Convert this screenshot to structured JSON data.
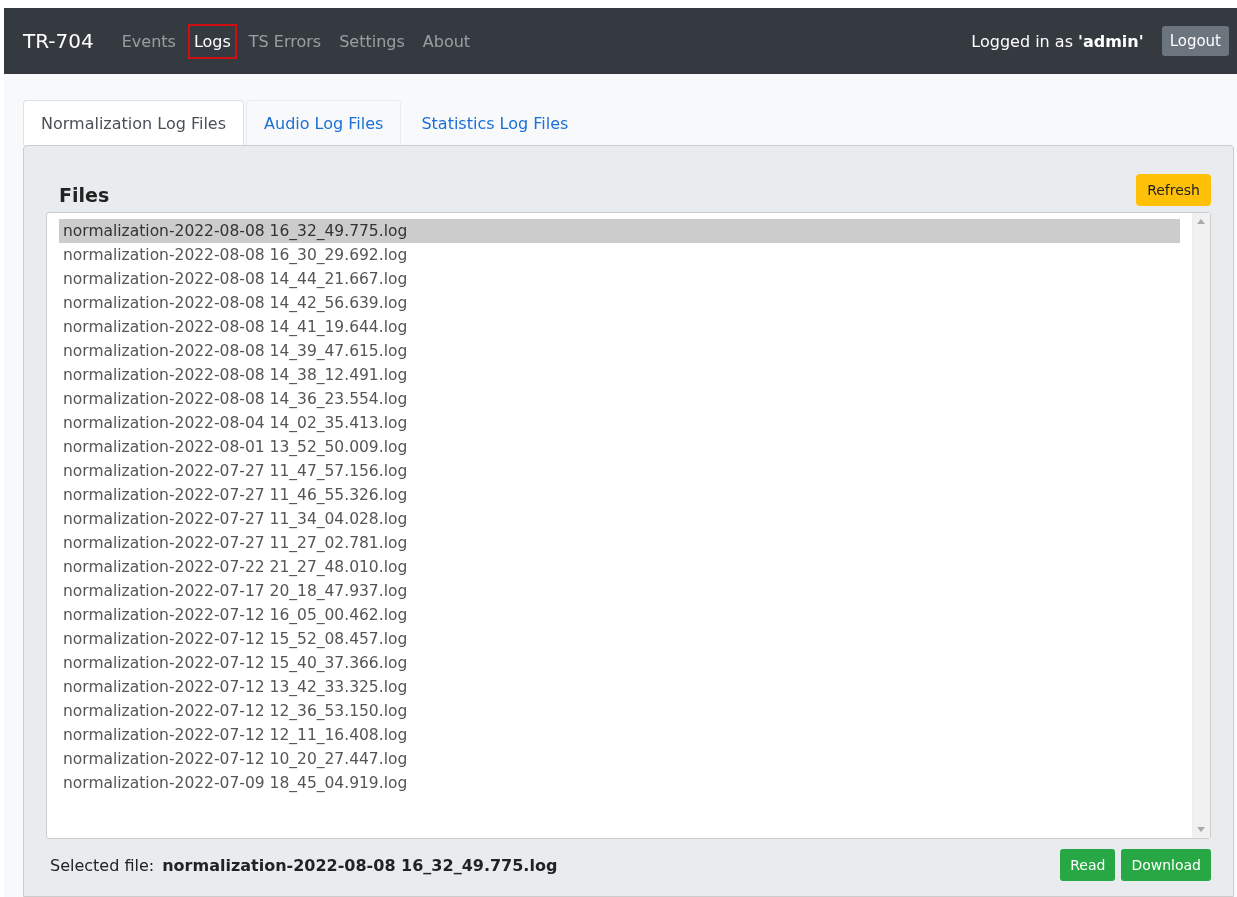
{
  "navbar": {
    "brand": "TR-704",
    "links": [
      {
        "label": "Events",
        "selected": false
      },
      {
        "label": "Logs",
        "selected": true
      },
      {
        "label": "TS Errors",
        "selected": false
      },
      {
        "label": "Settings",
        "selected": false
      },
      {
        "label": "About",
        "selected": false
      }
    ],
    "login_text": "Logged in as **'admin'**",
    "logout": "Logout"
  },
  "tabs": [
    {
      "label": "Normalization Log Files",
      "selected": true
    },
    {
      "label": "Audio Log Files",
      "selected": false
    },
    {
      "label": "Statistics Log Files",
      "selected": false
    }
  ],
  "files": {
    "title": "Files",
    "refresh": "Refresh",
    "items": [
      {
        "name": "normalization-2022-08-08 16_32_49.775.log",
        "selected": true
      },
      {
        "name": "normalization-2022-08-08 16_30_29.692.log",
        "selected": false
      },
      {
        "name": "normalization-2022-08-08 14_44_21.667.log",
        "selected": false
      },
      {
        "name": "normalization-2022-08-08 14_42_56.639.log",
        "selected": false
      },
      {
        "name": "normalization-2022-08-08 14_41_19.644.log",
        "selected": false
      },
      {
        "name": "normalization-2022-08-08 14_39_47.615.log",
        "selected": false
      },
      {
        "name": "normalization-2022-08-08 14_38_12.491.log",
        "selected": false
      },
      {
        "name": "normalization-2022-08-08 14_36_23.554.log",
        "selected": false
      },
      {
        "name": "normalization-2022-08-04 14_02_35.413.log",
        "selected": false
      },
      {
        "name": "normalization-2022-08-01 13_52_50.009.log",
        "selected": false
      },
      {
        "name": "normalization-2022-07-27 11_47_57.156.log",
        "selected": false
      },
      {
        "name": "normalization-2022-07-27 11_46_55.326.log",
        "selected": false
      },
      {
        "name": "normalization-2022-07-27 11_34_04.028.log",
        "selected": false
      },
      {
        "name": "normalization-2022-07-27 11_27_02.781.log",
        "selected": false
      },
      {
        "name": "normalization-2022-07-22 21_27_48.010.log",
        "selected": false
      },
      {
        "name": "normalization-2022-07-17 20_18_47.937.log",
        "selected": false
      },
      {
        "name": "normalization-2022-07-12 16_05_00.462.log",
        "selected": false
      },
      {
        "name": "normalization-2022-07-12 15_52_08.457.log",
        "selected": false
      },
      {
        "name": "normalization-2022-07-12 15_40_37.366.log",
        "selected": false
      },
      {
        "name": "normalization-2022-07-12 13_42_33.325.log",
        "selected": false
      },
      {
        "name": "normalization-2022-07-12 12_36_53.150.log",
        "selected": false
      },
      {
        "name": "normalization-2022-07-12 12_11_16.408.log",
        "selected": false
      },
      {
        "name": "normalization-2022-07-12 10_20_27.447.log",
        "selected": false
      },
      {
        "name": "normalization-2022-07-09 18_45_04.919.log",
        "selected": false
      }
    ],
    "selected_label": "Selected file:",
    "selected_file": "normalization-2022-08-08 16_32_49.775.log",
    "buttons": [
      {
        "label": "Read",
        "kind": "primary"
      },
      {
        "label": "Download",
        "kind": "primary"
      }
    ]
  }
}
